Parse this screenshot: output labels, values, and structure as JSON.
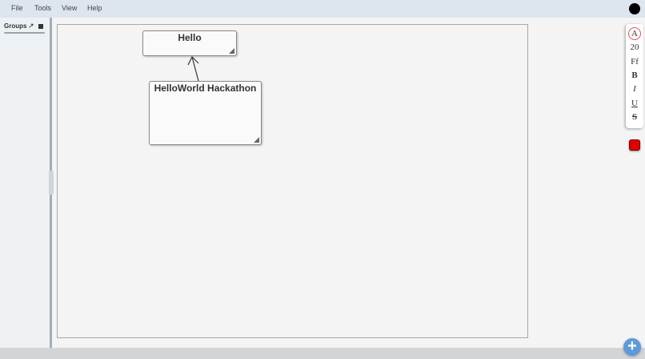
{
  "menu": {
    "items": [
      "File",
      "Tools",
      "View",
      "Help"
    ]
  },
  "sidebar": {
    "groups_label": "Groups",
    "expand_icon": "arrow-up-right-icon",
    "toggle_icon": "square-icon"
  },
  "canvas": {
    "nodes": [
      {
        "title": "Hello"
      },
      {
        "title": "HelloWorld Hackathon"
      }
    ]
  },
  "toolbar": {
    "font_label": "A",
    "size_label": "20",
    "family_label": "Ff",
    "bold_label": "B",
    "italic_label": "I",
    "underline_label": "U",
    "strike_label": "S",
    "selected_color": "#e00000"
  },
  "fab": {
    "label": "+"
  },
  "colors": {
    "menubar": "#dde5ee",
    "accent": "#5f9ad8",
    "avatar": "#000000"
  }
}
